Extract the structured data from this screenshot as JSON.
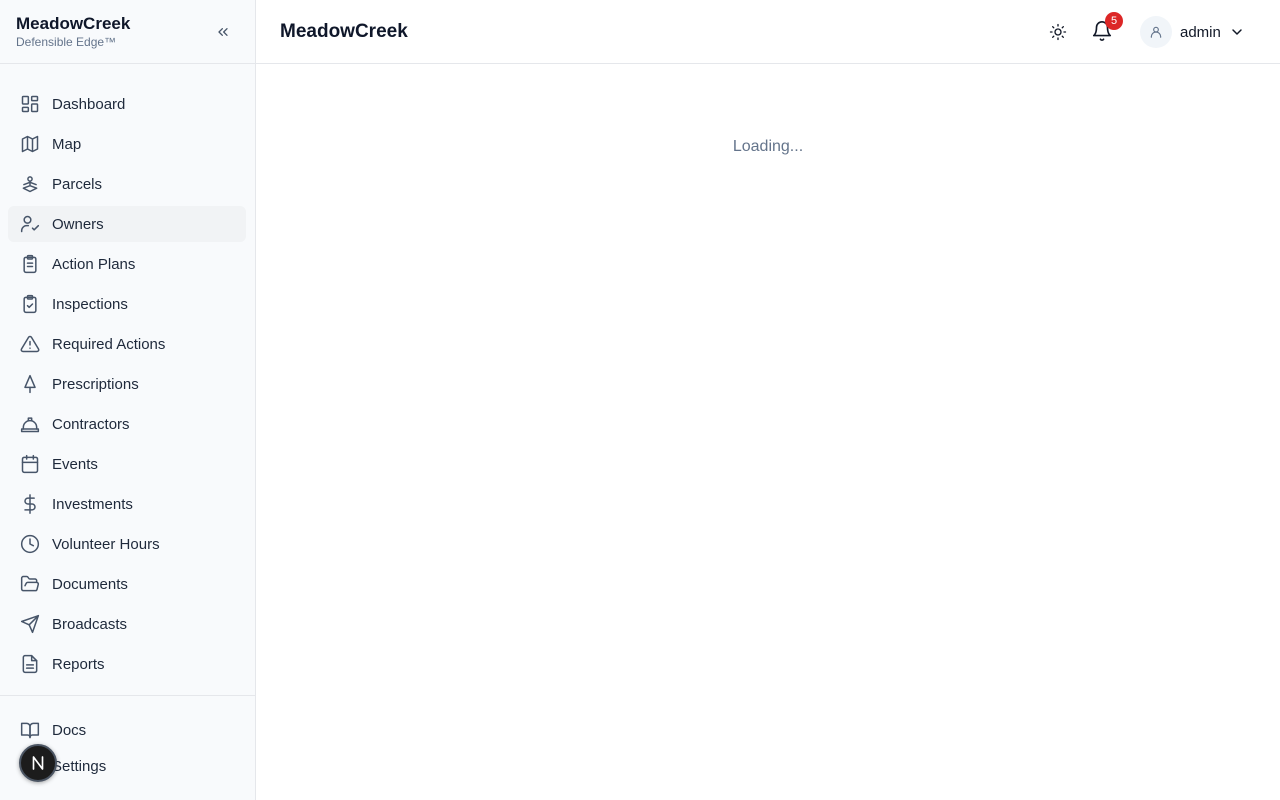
{
  "brand": {
    "title": "MeadowCreek",
    "subtitle": "Defensible Edge™"
  },
  "sidebar": {
    "items": [
      {
        "label": "Dashboard",
        "icon": "dashboard-icon"
      },
      {
        "label": "Map",
        "icon": "map-icon"
      },
      {
        "label": "Parcels",
        "icon": "parcels-icon"
      },
      {
        "label": "Owners",
        "icon": "owners-icon",
        "active": true
      },
      {
        "label": "Action Plans",
        "icon": "clipboard-icon"
      },
      {
        "label": "Inspections",
        "icon": "clipboard-check-icon"
      },
      {
        "label": "Required Actions",
        "icon": "warning-icon"
      },
      {
        "label": "Prescriptions",
        "icon": "tree-icon"
      },
      {
        "label": "Contractors",
        "icon": "hard-hat-icon"
      },
      {
        "label": "Events",
        "icon": "calendar-icon"
      },
      {
        "label": "Investments",
        "icon": "dollar-icon"
      },
      {
        "label": "Volunteer Hours",
        "icon": "clock-icon"
      },
      {
        "label": "Documents",
        "icon": "folder-open-icon"
      },
      {
        "label": "Broadcasts",
        "icon": "send-icon"
      },
      {
        "label": "Reports",
        "icon": "file-text-icon"
      }
    ],
    "bottom_items": [
      {
        "label": "Docs",
        "icon": "book-icon"
      },
      {
        "label": "Settings",
        "icon": "settings-icon"
      }
    ]
  },
  "header": {
    "title": "MeadowCreek",
    "notification_count": "5",
    "user": "admin"
  },
  "main": {
    "loading_text": "Loading..."
  },
  "fab": {
    "icon": "n-logo-icon"
  },
  "colors": {
    "sidebar_bg": "#f8fafc",
    "active_bg": "#f1f3f5",
    "badge": "#dc2626"
  }
}
